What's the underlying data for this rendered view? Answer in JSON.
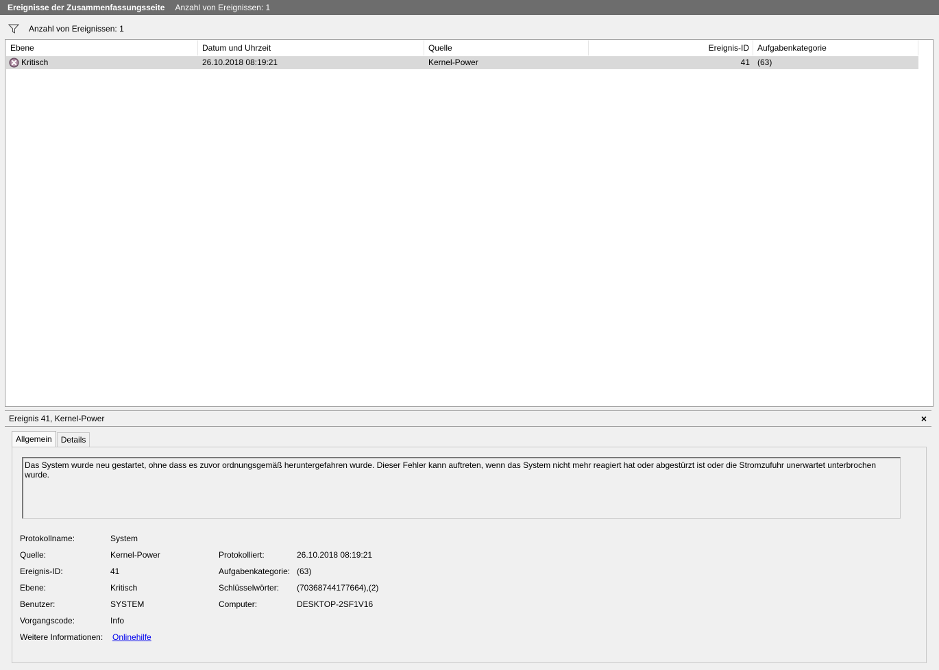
{
  "titlebar": {
    "title": "Ereignisse der Zusammenfassungsseite",
    "count": "Anzahl von Ereignissen: 1"
  },
  "filterbar": {
    "icon": "filter-icon",
    "count": "Anzahl von Ereignissen: 1"
  },
  "table": {
    "columns": [
      "Ebene",
      "Datum und Uhrzeit",
      "Quelle",
      "Ereignis-ID",
      "Aufgabenkategorie"
    ],
    "rows": [
      {
        "level_icon": "critical-error-icon",
        "level": "Kritisch",
        "datetime": "26.10.2018 08:19:21",
        "source": "Kernel-Power",
        "event_id": "41",
        "category": "(63)"
      }
    ]
  },
  "detail": {
    "title": "Ereignis 41, Kernel-Power",
    "close_label": "×",
    "tabs": [
      "Allgemein",
      "Details"
    ],
    "active_tab": "Allgemein",
    "message": "Das System wurde neu gestartet, ohne dass es zuvor ordnungsgemäß heruntergefahren wurde. Dieser Fehler kann auftreten, wenn das System nicht mehr reagiert hat oder abgestürzt ist oder die Stromzufuhr unerwartet unterbrochen wurde.",
    "labels": {
      "logname": "Protokollname:",
      "source": "Quelle:",
      "event_id": "Ereignis-ID:",
      "level": "Ebene:",
      "user": "Benutzer:",
      "opcode": "Vorgangscode:",
      "more_info": "Weitere Informationen:",
      "logged": "Protokolliert:",
      "task_category": "Aufgabenkategorie:",
      "keywords": "Schlüsselwörter:",
      "computer": "Computer:"
    },
    "values": {
      "logname": "System",
      "source": "Kernel-Power",
      "event_id": "41",
      "level": "Kritisch",
      "user": "SYSTEM",
      "opcode": "Info",
      "more_info_link": "Onlinehilfe",
      "logged": "26.10.2018 08:19:21",
      "task_category": "(63)",
      "keywords": "(70368744177664),(2)",
      "computer": "DESKTOP-2SF1V16"
    }
  }
}
